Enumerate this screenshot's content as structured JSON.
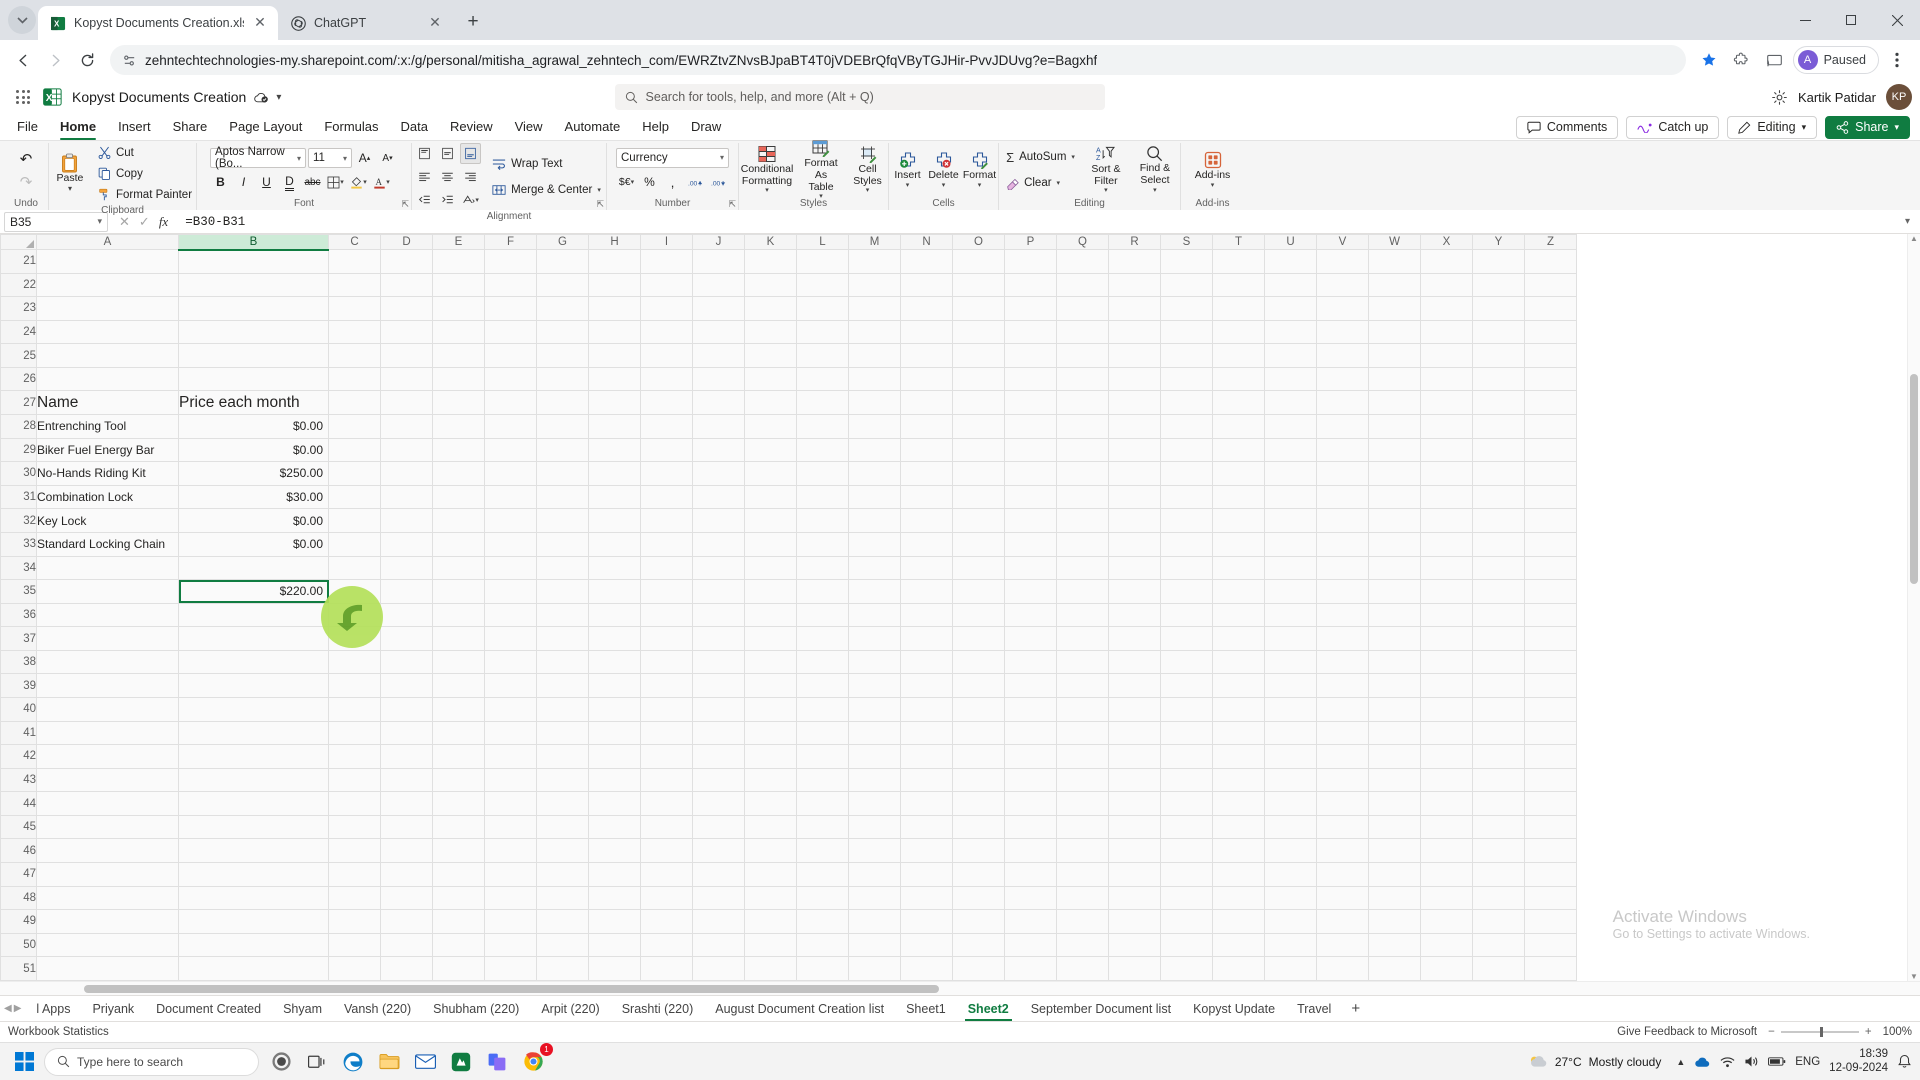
{
  "browser": {
    "tabs": [
      {
        "title": "Kopyst Documents Creation.xlsx",
        "favicon": "excel-icon",
        "active": true
      },
      {
        "title": "ChatGPT",
        "favicon": "chatgpt-icon",
        "active": false
      }
    ],
    "new_tab_label": "+",
    "window_controls": {
      "minimize": "–",
      "maximize": "☐",
      "close": "✕"
    },
    "url": "zehntechtechnologies-my.sharepoint.com/:x:/g/personal/mitisha_agrawal_zehntech_com/EWRZtvZNvsBJpaBT4T0jVDEBrQfqVByTGJHir-PvvJDUvg?e=Bagxhf",
    "paused_label": "Paused",
    "paused_avatar_letter": "A"
  },
  "app": {
    "title": "Kopyst Documents Creation",
    "search_placeholder": "Search for tools, help, and more (Alt + Q)",
    "user_name": "Kartik Patidar",
    "user_initials": "KP",
    "ribbon_tabs": [
      {
        "label": "File",
        "active": false
      },
      {
        "label": "Home",
        "active": true
      },
      {
        "label": "Insert",
        "active": false
      },
      {
        "label": "Share",
        "active": false
      },
      {
        "label": "Page Layout",
        "active": false
      },
      {
        "label": "Formulas",
        "active": false
      },
      {
        "label": "Data",
        "active": false
      },
      {
        "label": "Review",
        "active": false
      },
      {
        "label": "View",
        "active": false
      },
      {
        "label": "Automate",
        "active": false
      },
      {
        "label": "Help",
        "active": false
      },
      {
        "label": "Draw",
        "active": false
      }
    ],
    "header_buttons": {
      "comments": "Comments",
      "catch_up": "Catch up",
      "editing": "Editing",
      "share": "Share"
    }
  },
  "ribbon": {
    "undo": {
      "group_label": "Undo",
      "undo_glyph": "↶",
      "redo_glyph": "↷"
    },
    "clipboard": {
      "group_label": "Clipboard",
      "paste": "Paste",
      "cut": "Cut",
      "copy": "Copy",
      "format_painter": "Format Painter"
    },
    "font": {
      "group_label": "Font",
      "font_name": "Aptos Narrow (Bo...",
      "font_size": "11",
      "grow_font": "A",
      "shrink_font": "A",
      "bold": "B",
      "italic": "I",
      "underline": "U",
      "double_underline": "D",
      "strikethrough": "abc",
      "borders": "⊞",
      "fill_color": "A",
      "font_color": "A"
    },
    "alignment": {
      "group_label": "Alignment",
      "wrap_text": "Wrap Text",
      "merge_center": "Merge & Center"
    },
    "number": {
      "group_label": "Number",
      "format": "Currency",
      "accounting": "$€",
      "percent": "%",
      "comma": ",",
      "increase_decimal": "→.00",
      "decrease_decimal": ".00←"
    },
    "styles": {
      "group_label": "Styles",
      "conditional_formatting": "Conditional Formatting",
      "format_as_table": "Format As Table",
      "cell_styles": "Cell Styles"
    },
    "cells": {
      "group_label": "Cells",
      "insert": "Insert",
      "delete": "Delete",
      "format": "Format"
    },
    "editing": {
      "group_label": "Editing",
      "autosum": "AutoSum",
      "clear": "Clear",
      "sort_filter": "Sort & Filter",
      "find_select": "Find & Select"
    },
    "addins": {
      "group_label": "Add-ins",
      "addins": "Add-ins"
    }
  },
  "formula_bar": {
    "name_box": "B35",
    "cancel": "✕",
    "enter": "✓",
    "insert_function": "fx",
    "formula": "=B30-B31"
  },
  "grid": {
    "columns": [
      "A",
      "B",
      "C",
      "D",
      "E",
      "F",
      "G",
      "H",
      "I",
      "J",
      "K",
      "L",
      "M",
      "N",
      "O",
      "P",
      "Q",
      "R",
      "S",
      "T",
      "U",
      "V",
      "W",
      "X",
      "Y",
      "Z"
    ],
    "selected_column": "B",
    "selected_cell": "B35",
    "first_visible_row": 21,
    "last_visible_row": 51,
    "rows": [
      {
        "row": 21,
        "a": "",
        "b": ""
      },
      {
        "row": 22,
        "a": "",
        "b": ""
      },
      {
        "row": 23,
        "a": "",
        "b": ""
      },
      {
        "row": 24,
        "a": "",
        "b": ""
      },
      {
        "row": 25,
        "a": "",
        "b": ""
      },
      {
        "row": 26,
        "a": "",
        "b": ""
      },
      {
        "row": 27,
        "a": "Name",
        "b": "Price each month",
        "header": true
      },
      {
        "row": 28,
        "a": "Entrenching Tool",
        "b": "$0.00"
      },
      {
        "row": 29,
        "a": "Biker Fuel Energy Bar",
        "b": "$0.00"
      },
      {
        "row": 30,
        "a": "No-Hands Riding Kit",
        "b": "$250.00"
      },
      {
        "row": 31,
        "a": "Combination Lock",
        "b": "$30.00"
      },
      {
        "row": 32,
        "a": "Key Lock",
        "b": "$0.00"
      },
      {
        "row": 33,
        "a": "Standard Locking Chain",
        "b": "$0.00"
      },
      {
        "row": 34,
        "a": "",
        "b": ""
      },
      {
        "row": 35,
        "a": "",
        "b": "$220.00",
        "selected": true
      },
      {
        "row": 36,
        "a": "",
        "b": ""
      },
      {
        "row": 37,
        "a": "",
        "b": ""
      },
      {
        "row": 38,
        "a": "",
        "b": ""
      },
      {
        "row": 39,
        "a": "",
        "b": ""
      },
      {
        "row": 40,
        "a": "",
        "b": ""
      },
      {
        "row": 41,
        "a": "",
        "b": ""
      },
      {
        "row": 42,
        "a": "",
        "b": ""
      },
      {
        "row": 43,
        "a": "",
        "b": ""
      },
      {
        "row": 44,
        "a": "",
        "b": ""
      },
      {
        "row": 45,
        "a": "",
        "b": ""
      },
      {
        "row": 46,
        "a": "",
        "b": ""
      },
      {
        "row": 47,
        "a": "",
        "b": ""
      },
      {
        "row": 48,
        "a": "",
        "b": ""
      },
      {
        "row": 49,
        "a": "",
        "b": ""
      },
      {
        "row": 50,
        "a": "",
        "b": ""
      },
      {
        "row": 51,
        "a": "",
        "b": ""
      }
    ]
  },
  "sheet_tabs": {
    "items": [
      {
        "label": "l Apps",
        "active": false
      },
      {
        "label": "Priyank",
        "active": false
      },
      {
        "label": "Document Created",
        "active": false
      },
      {
        "label": "Shyam",
        "active": false
      },
      {
        "label": "Vansh (220)",
        "active": false
      },
      {
        "label": "Shubham (220)",
        "active": false
      },
      {
        "label": "Arpit (220)",
        "active": false
      },
      {
        "label": "Srashti (220)",
        "active": false
      },
      {
        "label": "August Document Creation list",
        "active": false
      },
      {
        "label": "Sheet1",
        "active": false
      },
      {
        "label": "Sheet2",
        "active": true
      },
      {
        "label": "September Document list",
        "active": false
      },
      {
        "label": "Kopyst Update",
        "active": false
      },
      {
        "label": "Travel",
        "active": false
      }
    ],
    "add_sheet": "+"
  },
  "status_bar": {
    "workbook_statistics": "Workbook Statistics",
    "feedback": "Give Feedback to Microsoft",
    "zoom": "100%",
    "zoom_out": "−",
    "zoom_in": "+"
  },
  "watermark": {
    "line1": "Activate Windows",
    "line2": "Go to Settings to activate Windows."
  },
  "taskbar": {
    "search_placeholder": "Type here to search",
    "weather_temp": "27°C",
    "weather_desc": "Mostly cloudy",
    "language": "ENG",
    "time": "18:39",
    "date": "12-09-2024",
    "notification_count": "1"
  },
  "colors": {
    "excel_green": "#107c41",
    "chrome_tabstrip": "#dee1e6",
    "ribbon_bg": "#f5f5f5",
    "cursor_green": "#b4e05a",
    "selection_header": "#cdebd7"
  }
}
